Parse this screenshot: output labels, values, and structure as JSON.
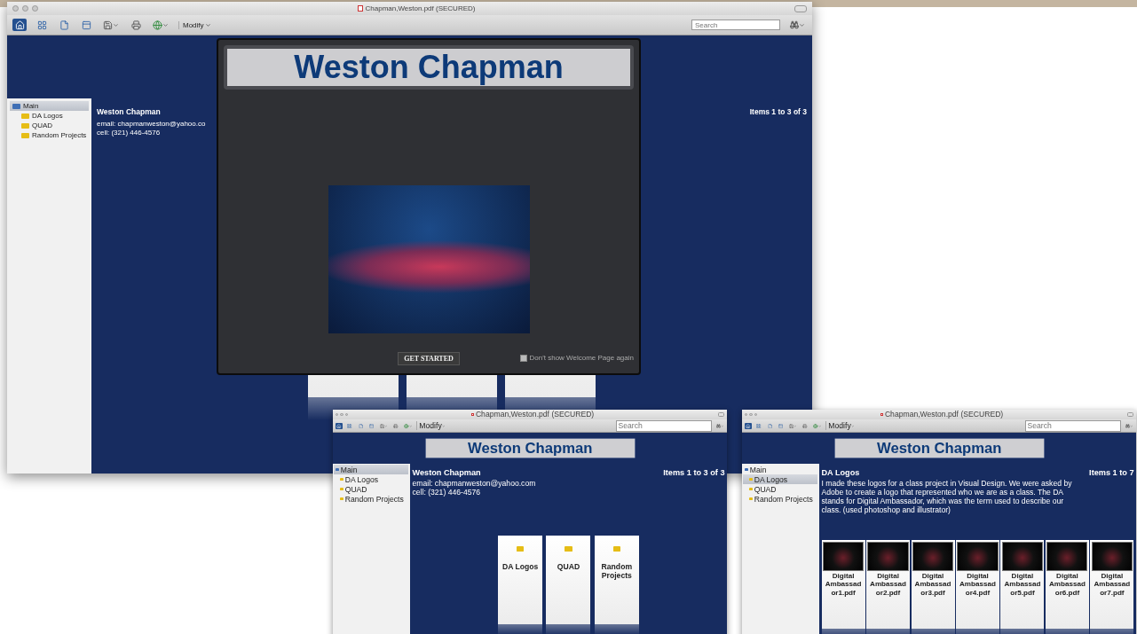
{
  "windows": [
    {
      "kind": "main",
      "title": "Chapman,Weston.pdf (SECURED)",
      "toolbar": {
        "menu": "Modify",
        "search_placeholder": "Search"
      },
      "sidebar": [
        {
          "label": "Main",
          "kind": "home",
          "selected": true
        },
        {
          "label": "DA Logos",
          "kind": "folder",
          "selected": false
        },
        {
          "label": "QUAD",
          "kind": "folder",
          "selected": false
        },
        {
          "label": "Random Projects",
          "kind": "folder",
          "selected": false
        }
      ],
      "header": {
        "name": "Weston Chapman",
        "lines": [
          "email: chapmanweston@yahoo.co",
          "cell: (321) 446-4576"
        ]
      },
      "item_count": "Items 1 to 3 of 3",
      "cards": [
        {
          "kind": "folder"
        },
        {
          "kind": "folder"
        },
        {
          "kind": "folder"
        }
      ],
      "dialog": {
        "banner": "Weston Chapman",
        "button": "GET STARTED",
        "checkbox": {
          "label": "Don't show Welcome Page again",
          "checked": false
        }
      }
    },
    {
      "kind": "mini",
      "title": "Chapman,Weston.pdf (SECURED)",
      "toolbar": {
        "menu": "Modify",
        "search_placeholder": "Search"
      },
      "banner": "Weston Chapman",
      "sidebar": [
        {
          "label": "Main",
          "kind": "home",
          "selected": true
        },
        {
          "label": "DA Logos",
          "kind": "folder",
          "selected": false
        },
        {
          "label": "QUAD",
          "kind": "folder",
          "selected": false
        },
        {
          "label": "Random Projects",
          "kind": "folder",
          "selected": false
        }
      ],
      "header": {
        "name": "Weston Chapman",
        "lines": [
          "email: chapmanweston@yahoo.com",
          "cell: (321) 446-4576"
        ]
      },
      "item_count": "Items 1 to 3 of 3",
      "cards": [
        {
          "kind": "folder",
          "title": "DA Logos"
        },
        {
          "kind": "folder",
          "title": "QUAD"
        },
        {
          "kind": "folder",
          "title": "Random Projects"
        }
      ]
    },
    {
      "kind": "mini",
      "title": "Chapman,Weston.pdf (SECURED)",
      "toolbar": {
        "menu": "Modify",
        "search_placeholder": "Search"
      },
      "banner": "Weston Chapman",
      "sidebar": [
        {
          "label": "Main",
          "kind": "home",
          "selected": false
        },
        {
          "label": "DA Logos",
          "kind": "folder",
          "selected": true
        },
        {
          "label": "QUAD",
          "kind": "folder",
          "selected": false
        },
        {
          "label": "Random Projects",
          "kind": "folder",
          "selected": false
        }
      ],
      "header": {
        "name": "DA Logos",
        "lines": [
          "I made these logos for a class project in Visual Design. We were asked by Adobe to create a logo that represented who we are as a class. The DA stands for Digital Ambassador, which was the term used to describe our class. (used photoshop and illustrator)"
        ]
      },
      "item_count": "Items 1 to 7",
      "cards": [
        {
          "kind": "file",
          "title": "Digital Ambassador1.pdf"
        },
        {
          "kind": "file",
          "title": "Digital Ambassador2.pdf"
        },
        {
          "kind": "file",
          "title": "Digital Ambassador3.pdf"
        },
        {
          "kind": "file",
          "title": "Digital Ambassador4.pdf"
        },
        {
          "kind": "file",
          "title": "Digital Ambassador5.pdf"
        },
        {
          "kind": "file",
          "title": "Digital Ambassador6.pdf"
        },
        {
          "kind": "file",
          "title": "Digital Ambassador7.pdf"
        }
      ]
    }
  ]
}
